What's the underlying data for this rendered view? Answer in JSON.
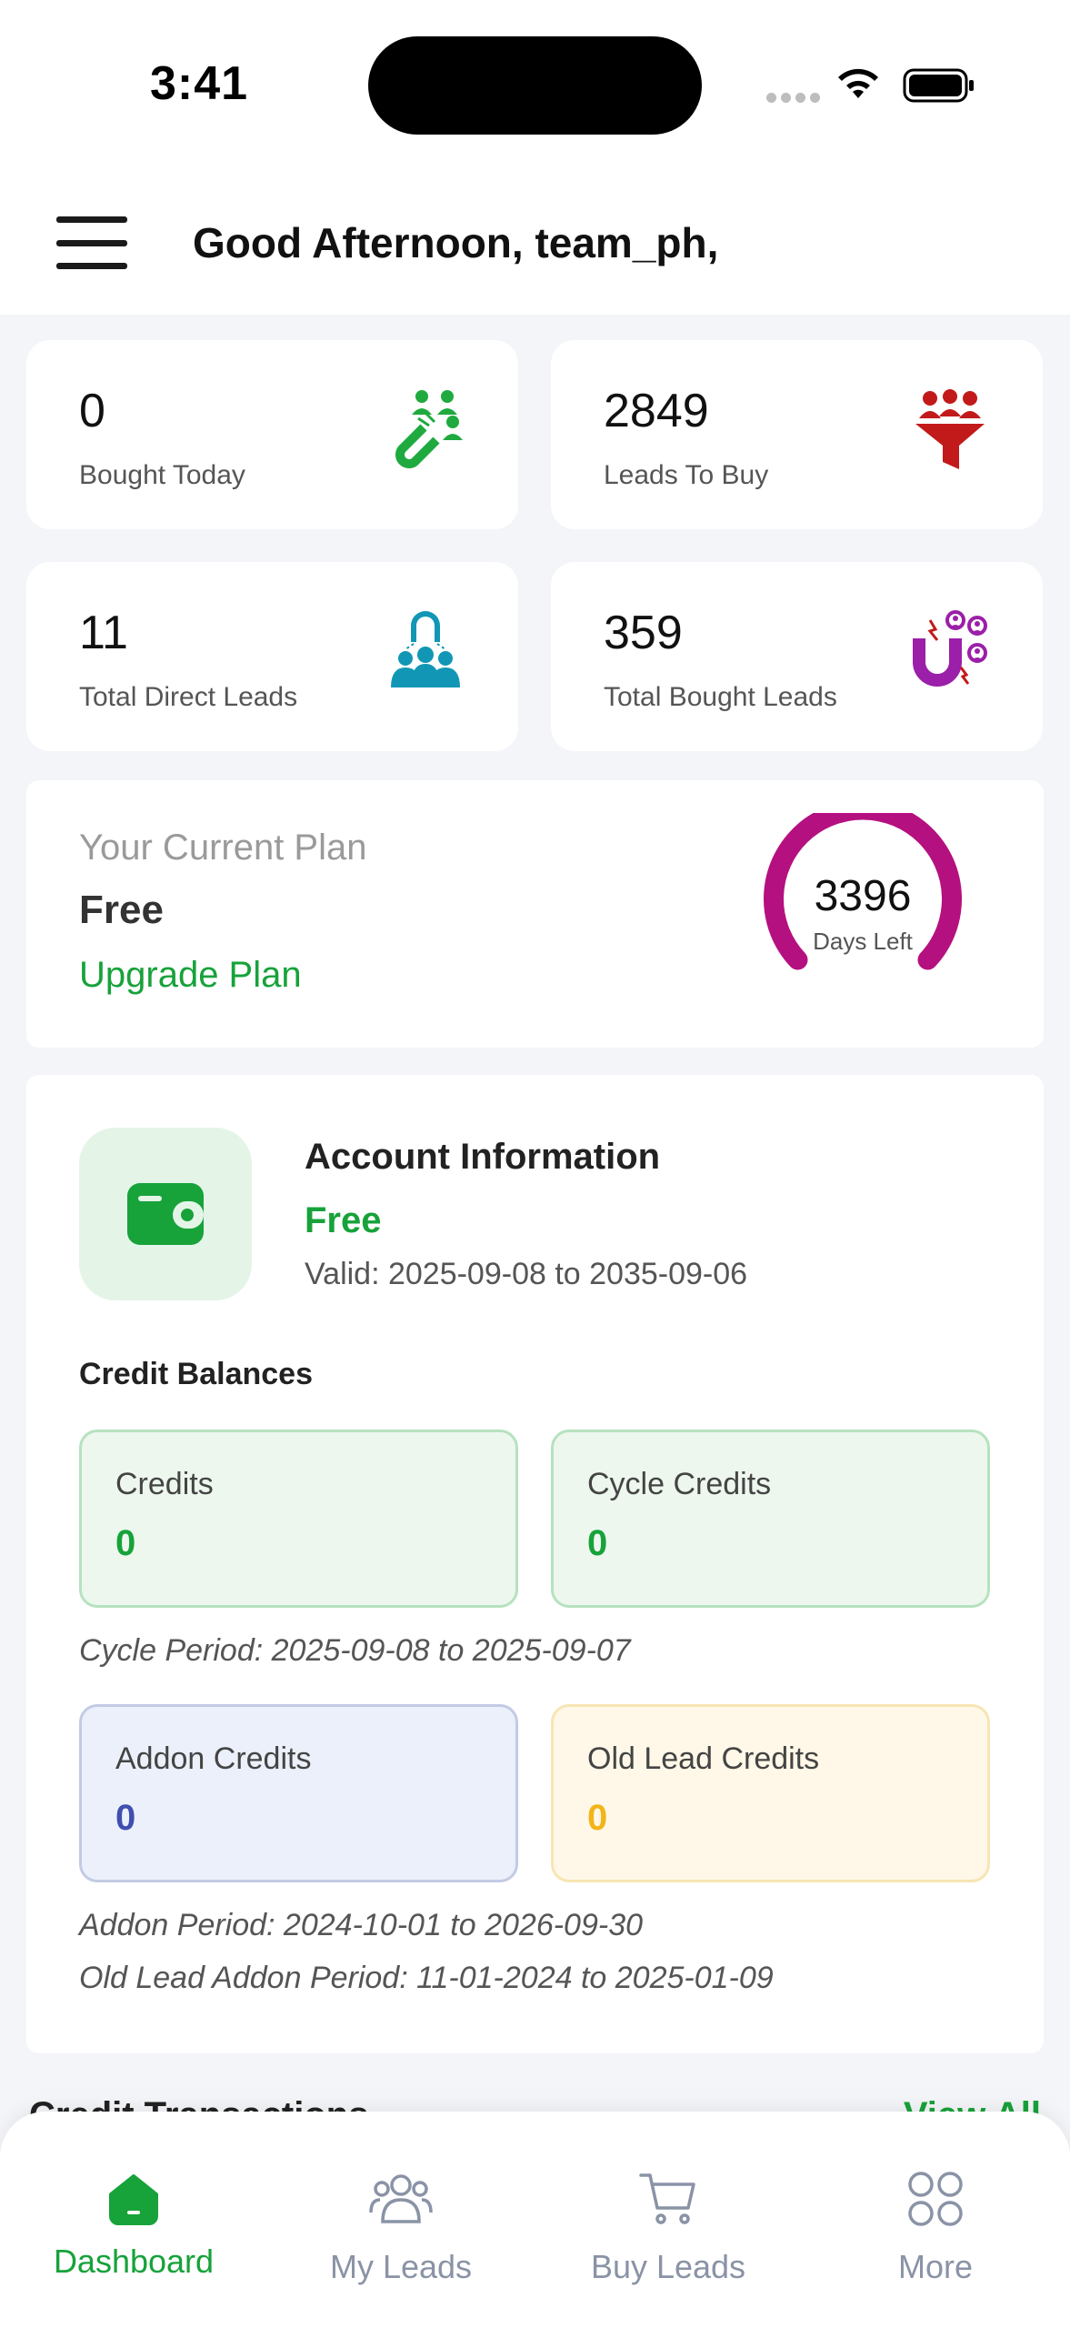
{
  "status_bar": {
    "time": "3:41"
  },
  "header": {
    "greeting": "Good Afternoon, team_ph,"
  },
  "stats": [
    {
      "value": "0",
      "label": "Bought Today",
      "icon": "magnet-people-icon",
      "color": "#1faa3f"
    },
    {
      "value": "2849",
      "label": "Leads To Buy",
      "icon": "people-funnel-icon",
      "color": "#c21a1a"
    },
    {
      "value": "11",
      "label": "Total Direct Leads",
      "icon": "direct-leads-icon",
      "color": "#1197b5"
    },
    {
      "value": "359",
      "label": "Total Bought Leads",
      "icon": "magnet-leads-icon",
      "color": "#9b1fa8"
    }
  ],
  "plan": {
    "title": "Your Current Plan",
    "name": "Free",
    "upgrade_label": "Upgrade Plan",
    "days_left": "3396",
    "days_left_label": "Days Left",
    "gauge_color": "#b5107f"
  },
  "account": {
    "title": "Account Information",
    "plan": "Free",
    "valid": "Valid: 2025-09-08 to 2035-09-06",
    "credit_balances_title": "Credit Balances",
    "credits": {
      "label": "Credits",
      "value": "0"
    },
    "cycle_credits": {
      "label": "Cycle Credits",
      "value": "0"
    },
    "cycle_period": "Cycle Period: 2025-09-08 to 2025-09-07",
    "addon_credits": {
      "label": "Addon Credits",
      "value": "0"
    },
    "old_lead_credits": {
      "label": "Old Lead Credits",
      "value": "0"
    },
    "addon_period": "Addon Period: 2024-10-01 to 2026-09-30",
    "old_lead_addon_period": "Old Lead Addon Period: 11-01-2024 to 2025-01-09"
  },
  "peek": {
    "left": "Credit Transactions",
    "right": "View All"
  },
  "nav": [
    {
      "label": "Dashboard",
      "icon": "home-icon",
      "active": true
    },
    {
      "label": "My Leads",
      "icon": "users-icon",
      "active": false
    },
    {
      "label": "Buy Leads",
      "icon": "cart-icon",
      "active": false
    },
    {
      "label": "More",
      "icon": "grid-icon",
      "active": false
    }
  ],
  "colors": {
    "accent": "#17a23a",
    "nav_inactive": "#8a93a6"
  }
}
